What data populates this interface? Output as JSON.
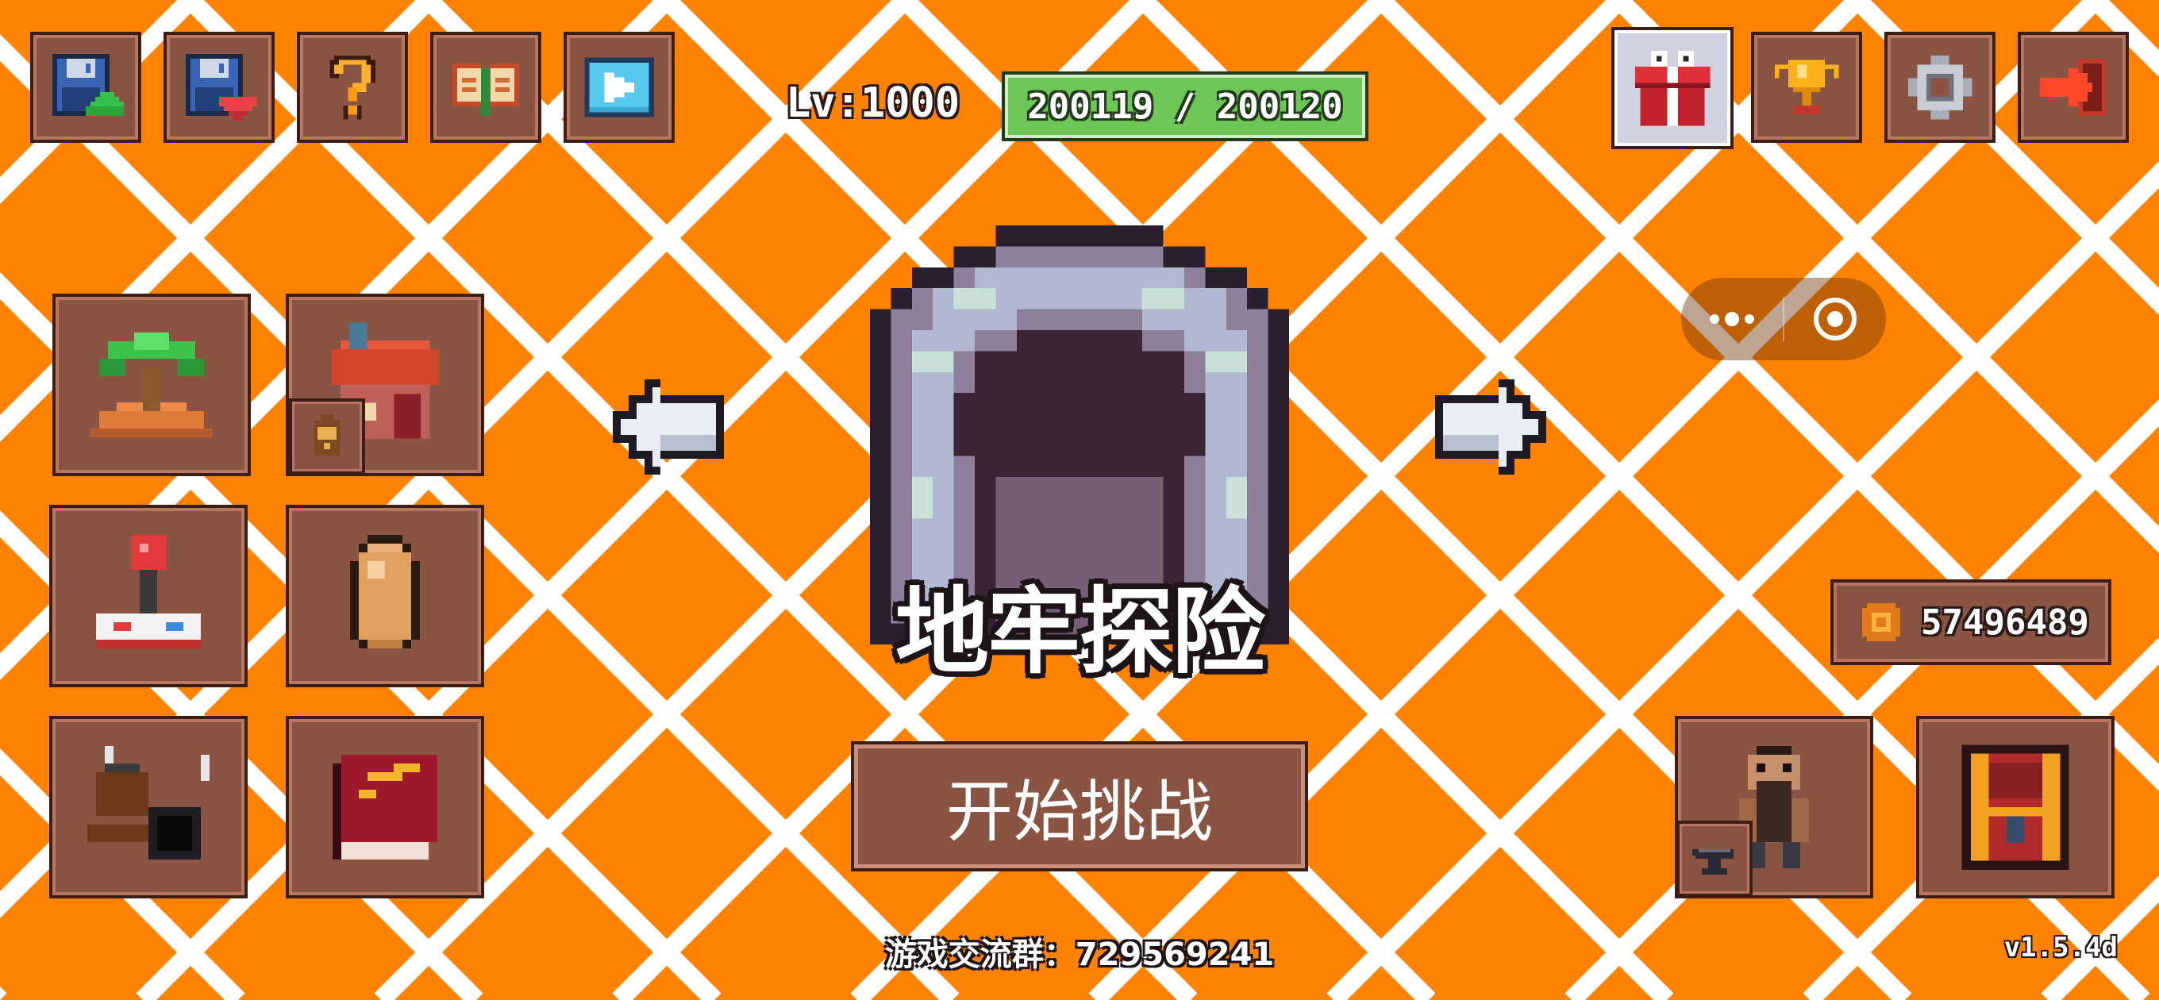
{
  "hud": {
    "level_text": "Lv:1000",
    "xp_text": "200119 / 200120",
    "xp_fill_fraction": 0.99999
  },
  "top_left_buttons": [
    {
      "name": "save-upload-button",
      "icon": "floppy-disk-upload-icon"
    },
    {
      "name": "save-download-button",
      "icon": "floppy-disk-download-icon"
    },
    {
      "name": "help-button",
      "icon": "question-mark-icon"
    },
    {
      "name": "guide-book-button",
      "icon": "open-book-icon"
    },
    {
      "name": "video-ad-button",
      "icon": "tv-play-icon"
    }
  ],
  "top_right_buttons": [
    {
      "name": "gift-button",
      "icon": "gift-box-icon"
    },
    {
      "name": "achievements-button",
      "icon": "trophy-icon"
    },
    {
      "name": "settings-button",
      "icon": "gear-icon"
    },
    {
      "name": "exit-button",
      "icon": "exit-arrow-icon"
    }
  ],
  "left_menu": [
    {
      "name": "island-button",
      "icon": "palm-island-icon"
    },
    {
      "name": "house-button",
      "icon": "brick-house-icon",
      "badge_icon": "backpack-icon"
    },
    {
      "name": "minigame-button",
      "icon": "joystick-icon"
    },
    {
      "name": "egg-button",
      "icon": "egg-icon"
    },
    {
      "name": "cooking-button",
      "icon": "cooking-pan-icon"
    },
    {
      "name": "journal-button",
      "icon": "red-book-icon"
    }
  ],
  "right_menu": [
    {
      "name": "blacksmith-button",
      "icon": "blacksmith-icon",
      "badge_icon": "anvil-icon"
    },
    {
      "name": "treasure-chest-button",
      "icon": "treasure-chest-icon"
    }
  ],
  "stage": {
    "title": "地牢探险",
    "portal_icon": "dungeon-cave-icon",
    "prev_icon": "arrow-left-icon",
    "next_icon": "arrow-right-icon",
    "start_button_label": "开始挑战"
  },
  "wallet": {
    "coins": "57496489",
    "coin_icon": "coin-icon"
  },
  "system_capsule": {
    "more_icon": "more-dots-icon",
    "close_icon": "target-close-icon"
  },
  "footer": {
    "group_text": "游戏交流群：729569241",
    "version": "v1.5.4d"
  },
  "colors": {
    "background": "#ff8200",
    "lattice": "#ffffff",
    "panel": "#8a5443",
    "xp_green": "#6dc656"
  }
}
